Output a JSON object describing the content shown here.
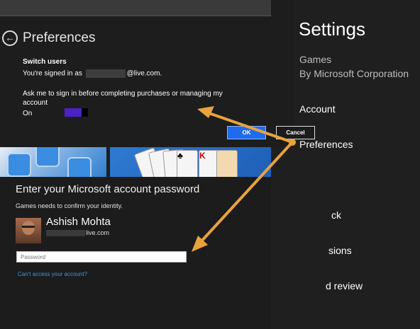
{
  "preferences": {
    "title": "Preferences",
    "switch_users_heading": "Switch users",
    "signed_in_prefix": "You're signed in as",
    "signed_in_suffix": "@live.com.",
    "ask_text": "Ask me to sign in before completing purchases or managing my account",
    "toggle_state": "On",
    "toggle_on": true
  },
  "dialog": {
    "title": "Enter your Microsoft account password",
    "subtitle": "Games needs to confirm your identity.",
    "user_name": "Ashish Mohta",
    "email_suffix": "live.com",
    "password_placeholder": "Password",
    "cant_access": "Can't access your account?",
    "ok_label": "OK",
    "cancel_label": "Cancel"
  },
  "settings": {
    "title": "Settings",
    "app_name": "Games",
    "publisher": "By Microsoft Corporation",
    "items": [
      {
        "label": "Account"
      },
      {
        "label": "Preferences"
      },
      {
        "label": "ck"
      },
      {
        "label": "sions"
      },
      {
        "label": "d review"
      }
    ]
  },
  "colors": {
    "arrow": "#e8a33d",
    "toggle_fill": "#4b22c8",
    "ok_button": "#1f6bf0",
    "link": "#3b9ae6"
  },
  "icons": {
    "back": "back-arrow-icon"
  }
}
